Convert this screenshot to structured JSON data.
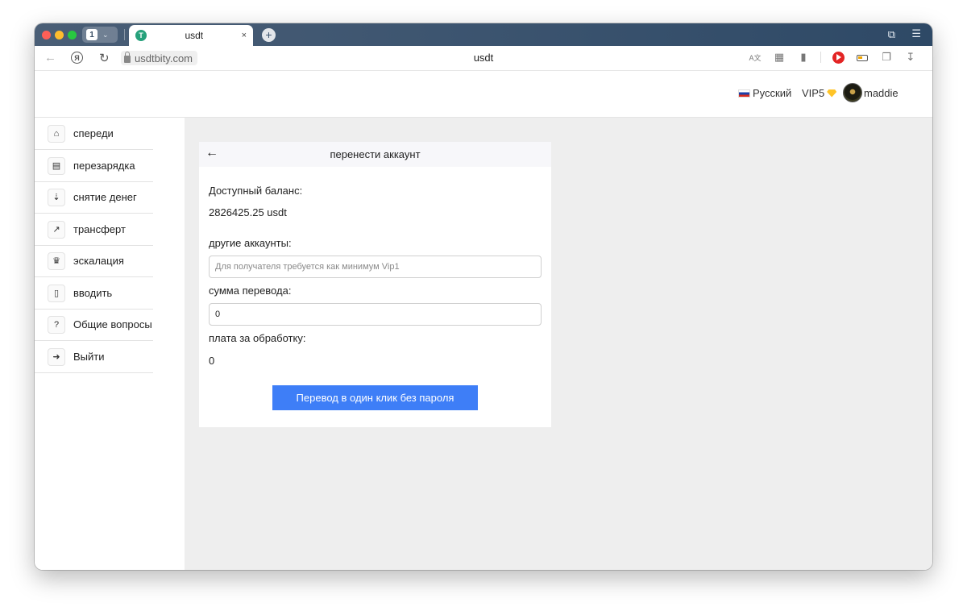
{
  "browser": {
    "tab_group_count": "1",
    "tab": {
      "title": "usdt",
      "favicon_letter": "T",
      "close": "×"
    },
    "new_tab": "+",
    "url": "usdtbity.com",
    "page_title": "usdt",
    "yandex_letter": "Я",
    "translate_icon": "A文",
    "colors": {
      "tabstrip": "#3d5570",
      "record": "#e32424"
    }
  },
  "header": {
    "language": "Русский",
    "vip": "VIP5",
    "username": "maddie"
  },
  "sidebar": {
    "items": [
      {
        "label": "спереди",
        "icon": "home-icon"
      },
      {
        "label": "перезарядка",
        "icon": "wallet-icon"
      },
      {
        "label": "снятие денег",
        "icon": "withdraw-icon"
      },
      {
        "label": "трансферт",
        "icon": "transfer-icon"
      },
      {
        "label": "эскалация",
        "icon": "crown-icon"
      },
      {
        "label": "вводить",
        "icon": "document-icon"
      },
      {
        "label": "Общие вопросы",
        "icon": "question-icon"
      },
      {
        "label": "Выйти",
        "icon": "logout-icon"
      }
    ]
  },
  "transfer": {
    "title": "перенести аккаунт",
    "balance_label": "Доступный баланс:",
    "balance_value": "2826425.25 usdt",
    "accounts_label": "другие аккаунты:",
    "accounts_placeholder": "Для получателя требуется как минимум Vip1",
    "amount_label": "сумма перевода:",
    "amount_value": "0",
    "fee_label": "плата за обработку:",
    "fee_value": "0",
    "submit_label": "Перевод в один клик без пароля",
    "colors": {
      "button": "#3e7ef7"
    }
  }
}
